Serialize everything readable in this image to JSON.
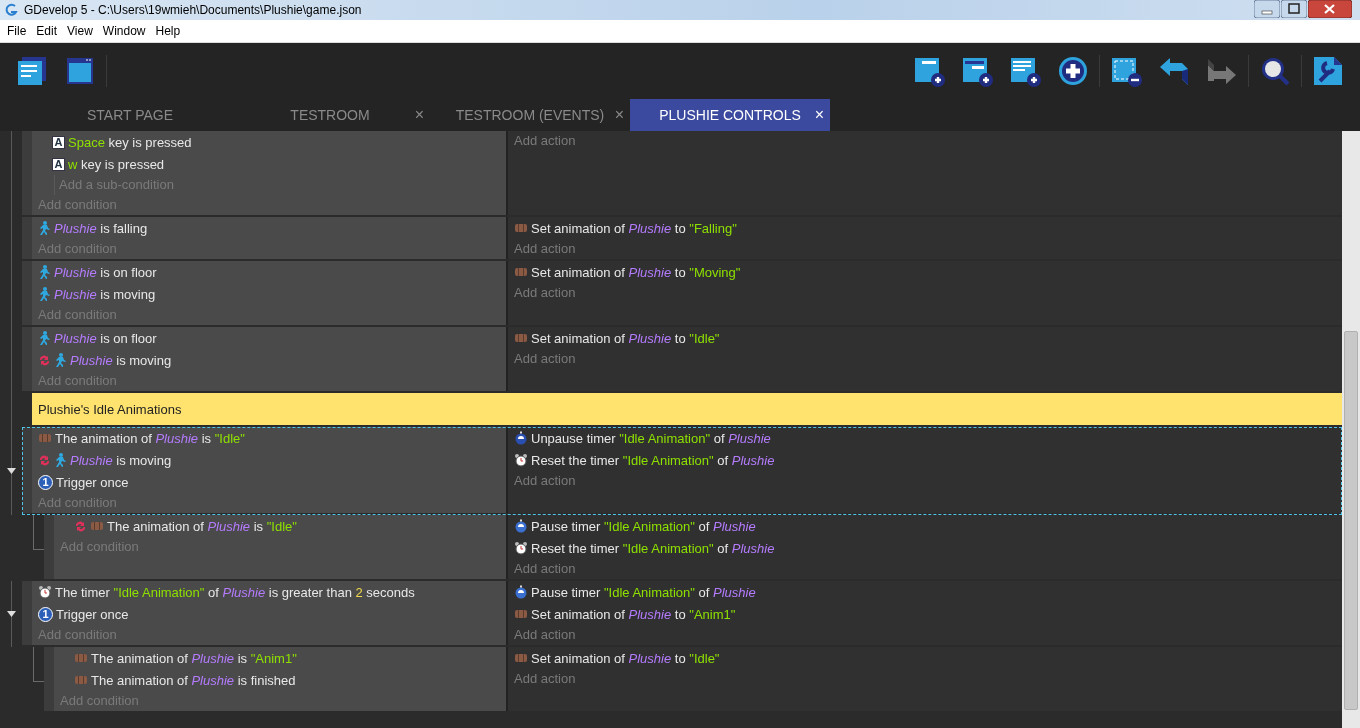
{
  "window": {
    "title": "GDevelop 5 - C:\\Users\\19wmieh\\Documents\\Plushie\\game.json"
  },
  "menu": [
    "File",
    "Edit",
    "View",
    "Window",
    "Help"
  ],
  "toolbar": {
    "left": [
      {
        "kind": "events-list"
      },
      {
        "kind": "scene"
      }
    ],
    "right": [
      {
        "kind": "add-event"
      },
      {
        "kind": "add-sub-event"
      },
      {
        "kind": "add-comment"
      },
      {
        "kind": "add-plus"
      },
      {
        "kind": "sep"
      },
      {
        "kind": "delete"
      },
      {
        "kind": "undo",
        "disabled": false
      },
      {
        "kind": "redo",
        "disabled": true
      },
      {
        "kind": "sep"
      },
      {
        "kind": "search"
      },
      {
        "kind": "sep"
      },
      {
        "kind": "settings"
      }
    ]
  },
  "tabs": [
    {
      "label": "START PAGE",
      "selected": false
    },
    {
      "label": "TESTROOM",
      "selected": false,
      "close": "×"
    },
    {
      "label": "TESTROOM (EVENTS)",
      "selected": false,
      "close": "×"
    },
    {
      "label": "PLUSHIE CONTROLS",
      "selected": true,
      "close": "×"
    }
  ],
  "events": [
    {
      "kind": "standard",
      "selected": false,
      "conditions": [
        {
          "kind": "group",
          "add_label": "Add a sub-condition",
          "children": [
            {
              "kind": "keyboard",
              "icon_text": "A",
              "parts": [
                {
                  "kind": "key",
                  "text": "Space"
                },
                {
                  "kind": "plain",
                  "text": " key is pressed"
                }
              ]
            },
            {
              "kind": "keyboard",
              "icon_text": "A",
              "parts": [
                {
                  "kind": "key",
                  "text": "w"
                },
                {
                  "kind": "plain",
                  "text": " key is pressed"
                }
              ]
            }
          ]
        }
      ],
      "add_condition": "Add condition",
      "add_action": "Add action"
    },
    {
      "kind": "standard",
      "selected": false,
      "conditions": [
        {
          "kind": "platformer",
          "parts": [
            {
              "kind": "object",
              "text": "Plushie"
            },
            {
              "kind": "plain",
              "text": " is falling"
            }
          ]
        }
      ],
      "add_condition": "Add condition",
      "actions": [
        {
          "kind": "animation",
          "parts": [
            {
              "kind": "plain",
              "text": "Set animation of "
            },
            {
              "kind": "object",
              "text": "Plushie"
            },
            {
              "kind": "plain",
              "text": " to "
            },
            {
              "kind": "string",
              "text": "\"Falling\""
            }
          ]
        }
      ],
      "add_action": "Add action"
    },
    {
      "kind": "standard",
      "selected": false,
      "conditions": [
        {
          "kind": "platformer",
          "parts": [
            {
              "kind": "object",
              "text": "Plushie"
            },
            {
              "kind": "plain",
              "text": " is on floor"
            }
          ]
        },
        {
          "kind": "platformer",
          "parts": [
            {
              "kind": "object",
              "text": "Plushie"
            },
            {
              "kind": "plain",
              "text": " is moving"
            }
          ]
        }
      ],
      "add_condition": "Add condition",
      "actions": [
        {
          "kind": "animation",
          "parts": [
            {
              "kind": "plain",
              "text": "Set animation of "
            },
            {
              "kind": "object",
              "text": "Plushie"
            },
            {
              "kind": "plain",
              "text": " to "
            },
            {
              "kind": "string",
              "text": "\"Moving\""
            }
          ]
        }
      ],
      "add_action": "Add action"
    },
    {
      "kind": "standard",
      "selected": false,
      "conditions": [
        {
          "kind": "platformer",
          "parts": [
            {
              "kind": "object",
              "text": "Plushie"
            },
            {
              "kind": "plain",
              "text": " is on floor"
            }
          ]
        },
        {
          "kind": "platformer",
          "inverted": true,
          "parts": [
            {
              "kind": "object",
              "text": "Plushie"
            },
            {
              "kind": "plain",
              "text": " is moving"
            }
          ]
        }
      ],
      "add_condition": "Add condition",
      "actions": [
        {
          "kind": "animation",
          "parts": [
            {
              "kind": "plain",
              "text": "Set animation of "
            },
            {
              "kind": "object",
              "text": "Plushie"
            },
            {
              "kind": "plain",
              "text": " to "
            },
            {
              "kind": "string",
              "text": "\"Idle\""
            }
          ]
        }
      ],
      "add_action": "Add action"
    },
    {
      "kind": "comment",
      "text": "Plushie's Idle Animations"
    },
    {
      "kind": "standard",
      "selected": true,
      "conditions": [
        {
          "kind": "animation",
          "parts": [
            {
              "kind": "plain",
              "text": "The animation of "
            },
            {
              "kind": "object",
              "text": "Plushie"
            },
            {
              "kind": "plain",
              "text": " is "
            },
            {
              "kind": "string",
              "text": "\"Idle\""
            }
          ]
        },
        {
          "kind": "platformer",
          "inverted": true,
          "parts": [
            {
              "kind": "object",
              "text": "Plushie"
            },
            {
              "kind": "plain",
              "text": " is moving"
            }
          ]
        },
        {
          "kind": "once",
          "icon_text": "1",
          "parts": [
            {
              "kind": "plain",
              "text": "Trigger once"
            }
          ]
        }
      ],
      "add_condition": "Add condition",
      "actions": [
        {
          "kind": "timer-unpause",
          "parts": [
            {
              "kind": "plain",
              "text": "Unpause timer "
            },
            {
              "kind": "string",
              "text": "\"Idle Animation\""
            },
            {
              "kind": "plain",
              "text": " of "
            },
            {
              "kind": "object",
              "text": "Plushie"
            }
          ]
        },
        {
          "kind": "timer",
          "parts": [
            {
              "kind": "plain",
              "text": "Reset the timer "
            },
            {
              "kind": "string",
              "text": "\"Idle Animation\""
            },
            {
              "kind": "plain",
              "text": " of "
            },
            {
              "kind": "object",
              "text": "Plushie"
            }
          ]
        }
      ],
      "add_action": "Add action",
      "children": [
        {
          "kind": "standard",
          "selected": false,
          "conditions": [
            {
              "kind": "animation",
              "inverted": true,
              "parts": [
                {
                  "kind": "plain",
                  "text": "The animation of "
                },
                {
                  "kind": "object",
                  "text": "Plushie"
                },
                {
                  "kind": "plain",
                  "text": " is "
                },
                {
                  "kind": "string",
                  "text": "\"Idle\""
                }
              ]
            }
          ],
          "add_condition": "Add condition",
          "actions": [
            {
              "kind": "timer-pause",
              "parts": [
                {
                  "kind": "plain",
                  "text": "Pause timer "
                },
                {
                  "kind": "string",
                  "text": "\"Idle Animation\""
                },
                {
                  "kind": "plain",
                  "text": " of "
                },
                {
                  "kind": "object",
                  "text": "Plushie"
                }
              ]
            },
            {
              "kind": "timer",
              "parts": [
                {
                  "kind": "plain",
                  "text": "Reset the timer "
                },
                {
                  "kind": "string",
                  "text": "\"Idle Animation\""
                },
                {
                  "kind": "plain",
                  "text": " of "
                },
                {
                  "kind": "object",
                  "text": "Plushie"
                }
              ]
            }
          ],
          "add_action": "Add action"
        }
      ]
    },
    {
      "kind": "standard",
      "selected": false,
      "conditions": [
        {
          "kind": "timer",
          "parts": [
            {
              "kind": "plain",
              "text": "The timer "
            },
            {
              "kind": "string",
              "text": "\"Idle Animation\""
            },
            {
              "kind": "plain",
              "text": " of "
            },
            {
              "kind": "object",
              "text": "Plushie"
            },
            {
              "kind": "plain",
              "text": " is greater than "
            },
            {
              "kind": "number",
              "text": "2"
            },
            {
              "kind": "plain",
              "text": " seconds"
            }
          ]
        },
        {
          "kind": "once",
          "icon_text": "1",
          "parts": [
            {
              "kind": "plain",
              "text": "Trigger once"
            }
          ]
        }
      ],
      "add_condition": "Add condition",
      "actions": [
        {
          "kind": "timer-pause",
          "parts": [
            {
              "kind": "plain",
              "text": "Pause timer "
            },
            {
              "kind": "string",
              "text": "\"Idle Animation\""
            },
            {
              "kind": "plain",
              "text": " of "
            },
            {
              "kind": "object",
              "text": "Plushie"
            }
          ]
        },
        {
          "kind": "animation",
          "parts": [
            {
              "kind": "plain",
              "text": "Set animation of "
            },
            {
              "kind": "object",
              "text": "Plushie"
            },
            {
              "kind": "plain",
              "text": " to "
            },
            {
              "kind": "string",
              "text": "\"Anim1\""
            }
          ]
        }
      ],
      "add_action": "Add action",
      "children": [
        {
          "kind": "standard",
          "selected": false,
          "conditions": [
            {
              "kind": "animation",
              "parts": [
                {
                  "kind": "plain",
                  "text": "The animation of "
                },
                {
                  "kind": "object",
                  "text": "Plushie"
                },
                {
                  "kind": "plain",
                  "text": " is "
                },
                {
                  "kind": "string",
                  "text": "\"Anim1\""
                }
              ]
            },
            {
              "kind": "animation",
              "parts": [
                {
                  "kind": "plain",
                  "text": "The animation of "
                },
                {
                  "kind": "object",
                  "text": "Plushie"
                },
                {
                  "kind": "plain",
                  "text": " is finished"
                }
              ]
            }
          ],
          "add_condition": "Add condition",
          "actions": [
            {
              "kind": "animation",
              "parts": [
                {
                  "kind": "plain",
                  "text": "Set animation of "
                },
                {
                  "kind": "object",
                  "text": "Plushie"
                },
                {
                  "kind": "plain",
                  "text": " to "
                },
                {
                  "kind": "string",
                  "text": "\"Idle\""
                }
              ]
            }
          ],
          "add_action": "Add action"
        }
      ]
    }
  ]
}
